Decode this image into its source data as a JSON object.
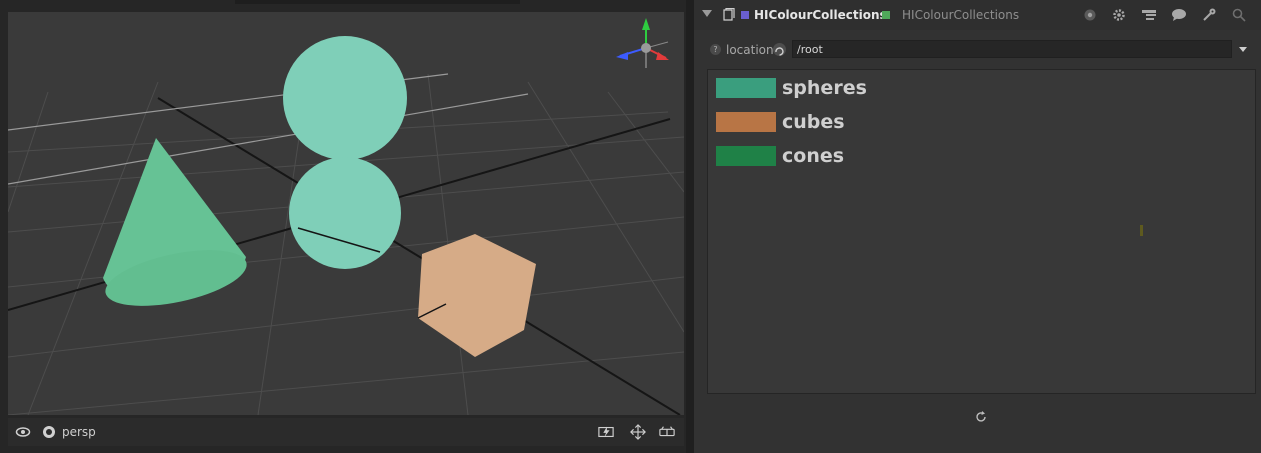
{
  "viewer": {
    "camera_label": "persp",
    "icons": [
      "eye-icon",
      "camera-icon",
      "flash-icon",
      "move-icon",
      "glasses-icon"
    ]
  },
  "panel": {
    "node_name": "HIColourCollections",
    "node_type": "HIColourCollections",
    "header_icons": [
      "circle-dot-icon",
      "gear-icon",
      "hierarchy-icon",
      "speech-bubble-icon",
      "wrench-icon",
      "magnifier-icon"
    ],
    "location": {
      "label": "location",
      "value": "/root"
    },
    "collections": [
      {
        "name": "spheres",
        "color": "#3a9e7e"
      },
      {
        "name": "cubes",
        "color": "#b87545"
      },
      {
        "name": "cones",
        "color": "#1f8147"
      }
    ]
  },
  "scene_colors": {
    "sphere": "#7fcfb8",
    "cone": "#66c295",
    "cube": "#d6ab87",
    "grid_bg": "#3a3a3a"
  }
}
